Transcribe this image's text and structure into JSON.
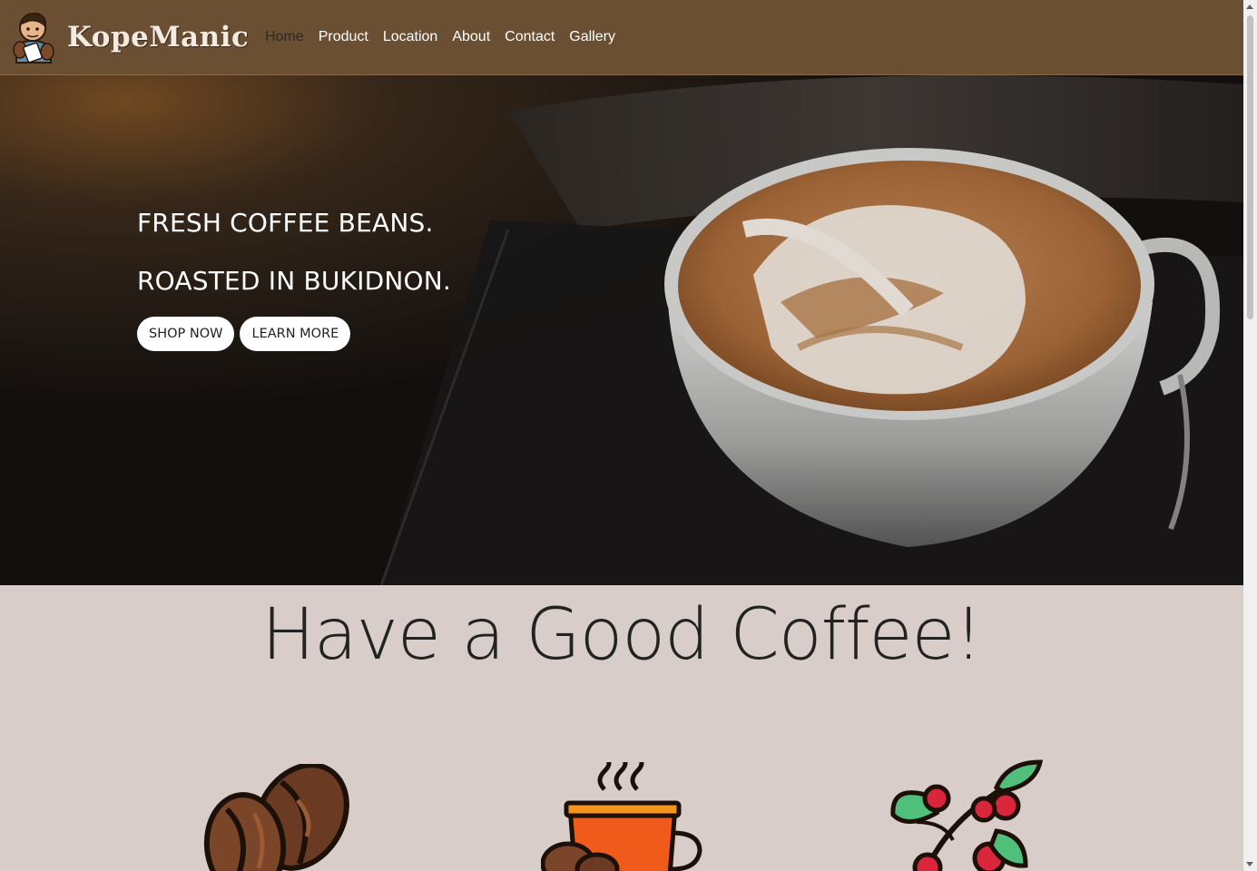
{
  "brand": {
    "name": "KopeManic",
    "logo_icon": "barista-mascot-icon"
  },
  "nav": {
    "items": [
      {
        "label": "Home",
        "active": true
      },
      {
        "label": "Product",
        "active": false
      },
      {
        "label": "Location",
        "active": false
      },
      {
        "label": "About",
        "active": false
      },
      {
        "label": "Contact",
        "active": false
      },
      {
        "label": "Gallery",
        "active": false
      }
    ]
  },
  "hero": {
    "line1": "FRESH COFFEE BEANS.",
    "line2": "ROASTED IN BUKIDNON.",
    "shop_button": "SHOP NOW",
    "learn_button": "LEARN MORE",
    "image": "latte-art-cup-photo"
  },
  "tagline": "Have a Good Coffee!",
  "features": [
    {
      "icon": "coffee-beans-icon"
    },
    {
      "icon": "hot-coffee-cup-icon"
    },
    {
      "icon": "coffee-cherry-branch-icon"
    }
  ],
  "colors": {
    "navbar": "#6b4f33",
    "page_background": "#d8cdc8",
    "button_background": "#ffffff"
  }
}
